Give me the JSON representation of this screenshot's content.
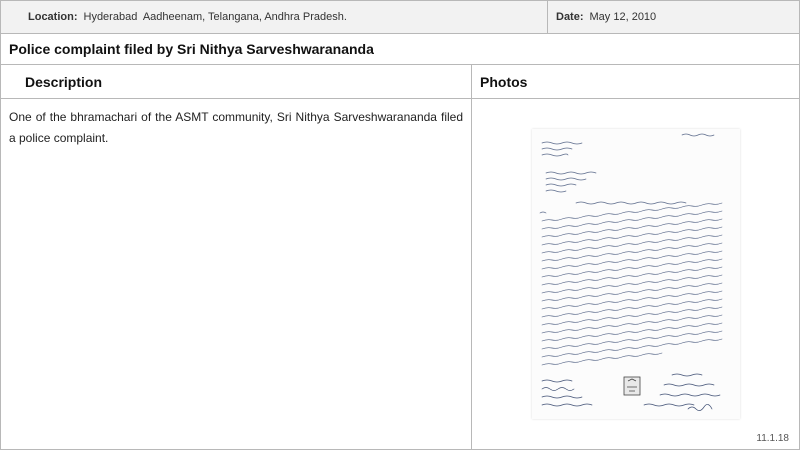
{
  "header": {
    "location_key": "Location:",
    "location_value": "Hyderabad  Aadheenam, Telangana, Andhra Pradesh.",
    "date_key": "Date:",
    "date_value": "May 12, 2010"
  },
  "title": "Police complaint filed by Sri Nithya Sarveshwarananda",
  "columns": {
    "description": "Description",
    "photos": "Photos"
  },
  "description_text": "One of the bhramachari of the ASMT community, Sri Nithya Sarveshwarananda filed a police complaint.",
  "photo": {
    "icon": "handwritten-letter-image"
  },
  "slide_number": "11.1.18"
}
